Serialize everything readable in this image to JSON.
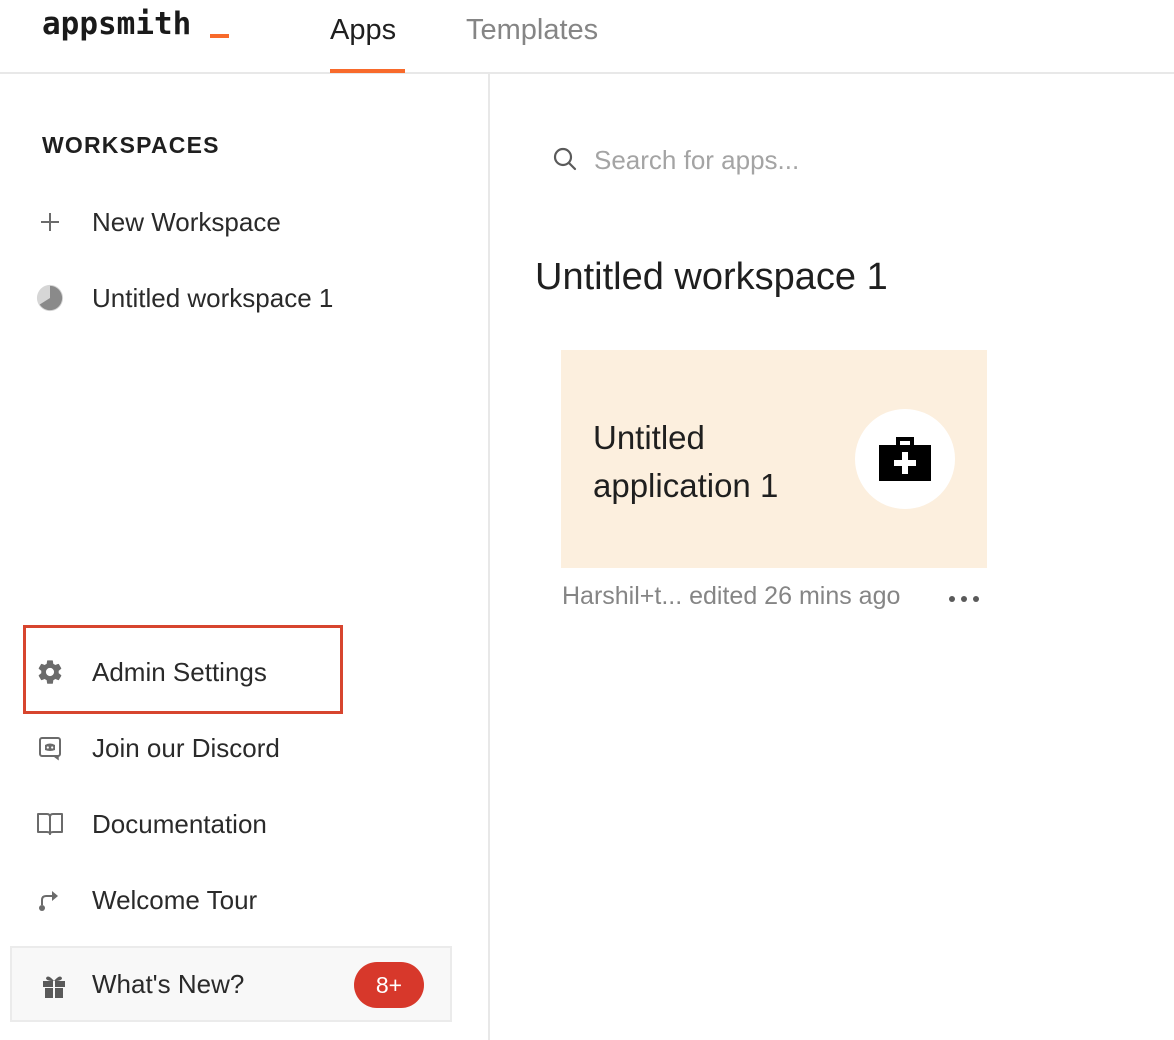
{
  "header": {
    "logo_text": "appsmith",
    "tabs": [
      {
        "label": "Apps",
        "active": true
      },
      {
        "label": "Templates",
        "active": false
      }
    ],
    "accent_color": "#f86a2b"
  },
  "sidebar": {
    "heading": "WORKSPACES",
    "top_items": [
      {
        "label": "New Workspace",
        "icon": "plus-icon"
      },
      {
        "label": "Untitled workspace 1",
        "icon": "workspace-avatar-icon"
      }
    ],
    "bottom_items": [
      {
        "label": "Admin Settings",
        "icon": "gear-icon",
        "highlighted": true
      },
      {
        "label": "Join our Discord",
        "icon": "discord-icon"
      },
      {
        "label": "Documentation",
        "icon": "book-icon"
      },
      {
        "label": "Welcome Tour",
        "icon": "route-icon"
      }
    ],
    "whats_new": {
      "label": "What's New?",
      "badge": "8+",
      "icon": "gift-icon",
      "badge_color": "#d7382b"
    },
    "highlight_color": "#d7452e"
  },
  "main": {
    "search": {
      "placeholder": "Search for apps...",
      "value": ""
    },
    "workspace_title": "Untitled workspace 1",
    "apps": [
      {
        "name": "Untitled application 1",
        "icon": "medical-kit-icon",
        "card_color": "#fcefde",
        "meta": "Harshil+t... edited 26 mins ago"
      }
    ]
  }
}
